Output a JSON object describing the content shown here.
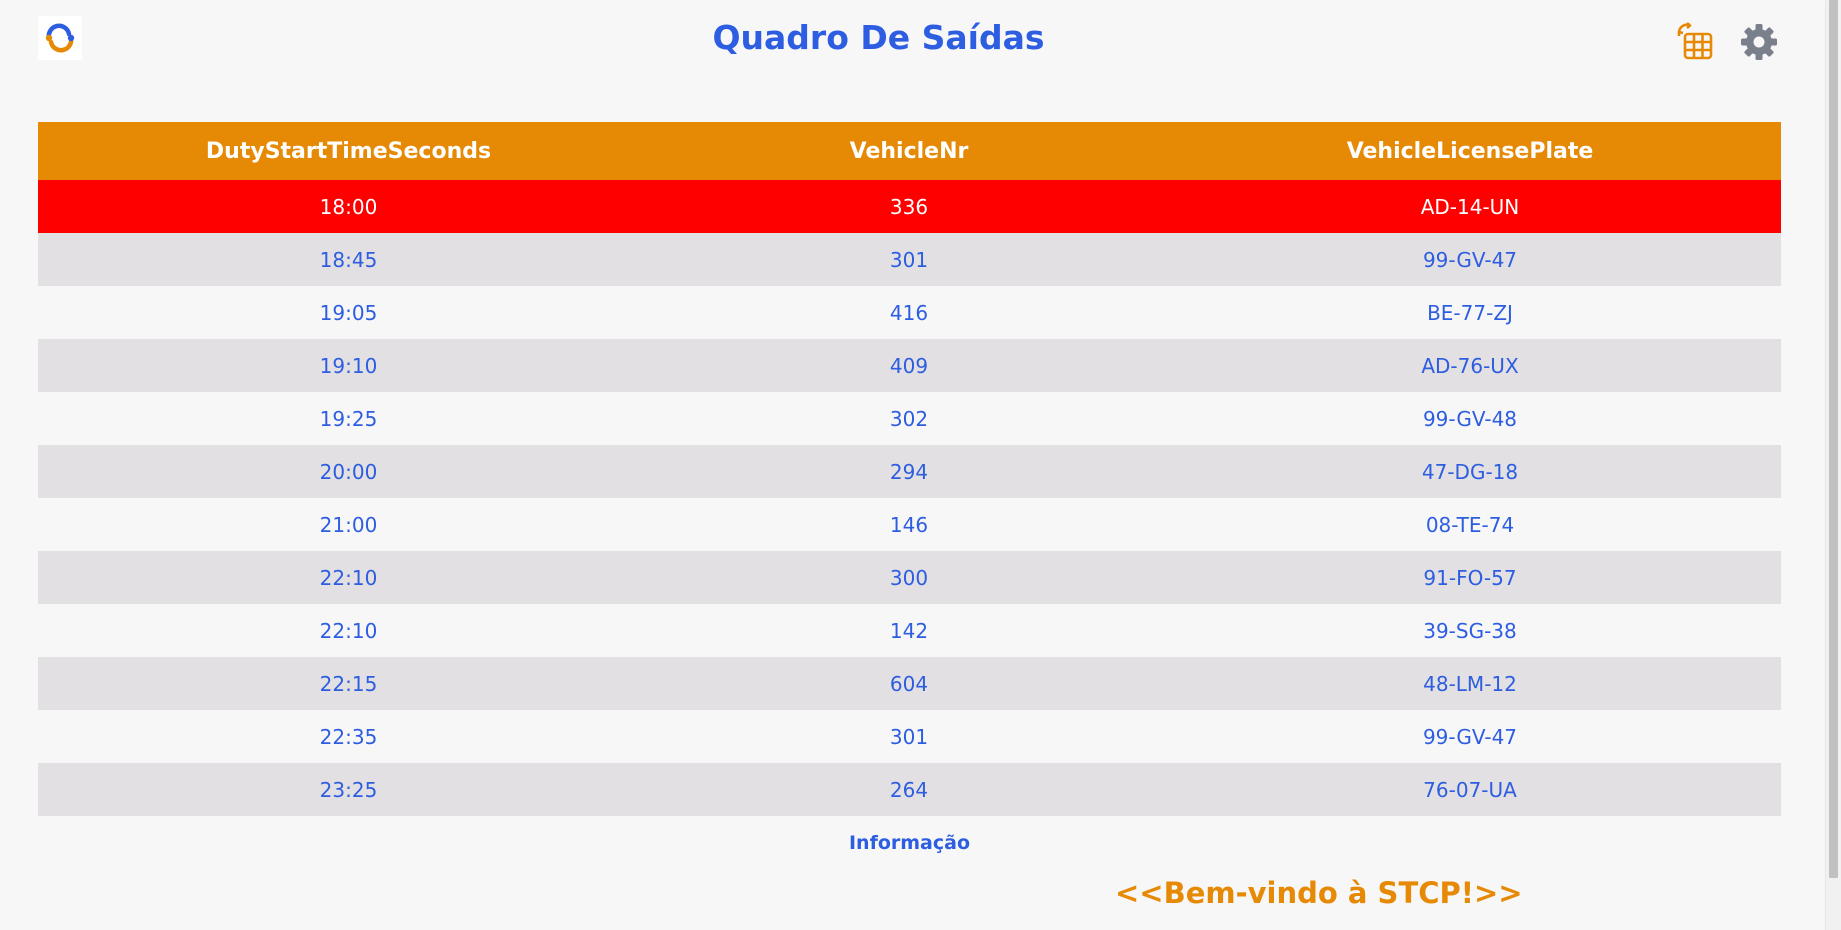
{
  "header": {
    "title": "Quadro De Saídas",
    "logo_icon": "stcp-logo-icon",
    "actions": [
      {
        "name": "table-refresh-icon",
        "color": "#e68a06"
      },
      {
        "name": "gear-icon",
        "color": "#7a7f8c"
      }
    ]
  },
  "colors": {
    "accent": "#e68a06",
    "primary_text": "#2d5de0",
    "highlight_row": "#ff0000",
    "row_alt": "#e2e0e2"
  },
  "table": {
    "columns": [
      "DutyStartTimeSeconds",
      "VehicleNr",
      "VehicleLicensePlate"
    ],
    "rows": [
      {
        "time": "18:00",
        "vehicle": "336",
        "plate": "AD-14-UN",
        "highlighted": true
      },
      {
        "time": "18:45",
        "vehicle": "301",
        "plate": "99-GV-47"
      },
      {
        "time": "19:05",
        "vehicle": "416",
        "plate": "BE-77-ZJ"
      },
      {
        "time": "19:10",
        "vehicle": "409",
        "plate": "AD-76-UX"
      },
      {
        "time": "19:25",
        "vehicle": "302",
        "plate": "99-GV-48"
      },
      {
        "time": "20:00",
        "vehicle": "294",
        "plate": "47-DG-18"
      },
      {
        "time": "21:00",
        "vehicle": "146",
        "plate": "08-TE-74"
      },
      {
        "time": "22:10",
        "vehicle": "300",
        "plate": "91-FO-57"
      },
      {
        "time": "22:10",
        "vehicle": "142",
        "plate": "39-SG-38"
      },
      {
        "time": "22:15",
        "vehicle": "604",
        "plate": "48-LM-12"
      },
      {
        "time": "22:35",
        "vehicle": "301",
        "plate": "99-GV-47"
      },
      {
        "time": "23:25",
        "vehicle": "264",
        "plate": "76-07-UA"
      }
    ]
  },
  "footer": {
    "info_label": "Informação",
    "welcome_text": "<<Bem-vindo à STCP!>>"
  }
}
